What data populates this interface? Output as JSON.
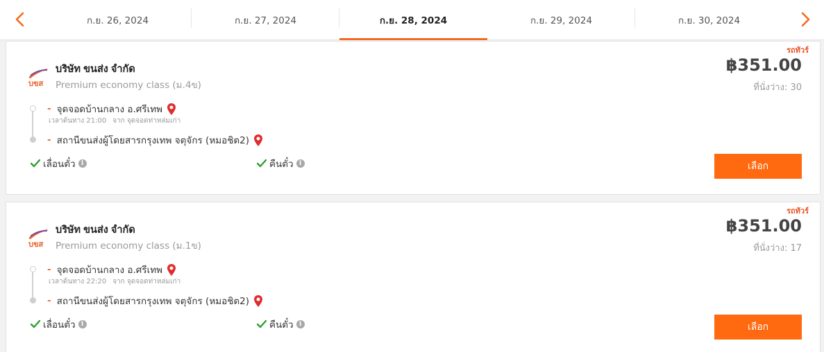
{
  "date_nav": {
    "prev_icon": "chevron-left-icon",
    "next_icon": "chevron-right-icon",
    "accent": "#f26a21",
    "dates": [
      {
        "label": "ก.ย. 26, 2024",
        "active": false
      },
      {
        "label": "ก.ย. 27, 2024",
        "active": false
      },
      {
        "label": "ก.ย. 28, 2024",
        "active": true
      },
      {
        "label": "ก.ย. 29, 2024",
        "active": false
      },
      {
        "label": "ก.ย. 30, 2024",
        "active": false
      }
    ]
  },
  "trips": [
    {
      "company": "บริษัท ขนส่ง จำกัด",
      "logo_text": "บขส",
      "class": "Premium economy class (ม.4ข)",
      "vehicle_type": "รถทัวร์",
      "price": "฿351.00",
      "seats": "ที่นั่งว่าง: 30",
      "from_stop": "จุดจอดบ้านกลาง อ.ศรีเทพ",
      "depart_time": "เวลาต้นทาง 21:00",
      "depart_from": "จาก จุดจอดท่าหล่มเก่า",
      "to_stop": "สถานีขนส่งผู้โดยสารกรุงเทพ จตุจักร (หมอชิต2)",
      "feature_change": "เลื่อนตั๋ว",
      "feature_refund": "คืนตั๋ว",
      "select_label": "เลือก"
    },
    {
      "company": "บริษัท ขนส่ง จำกัด",
      "logo_text": "บขส",
      "class": "Premium economy class (ม.1ข)",
      "vehicle_type": "รถทัวร์",
      "price": "฿351.00",
      "seats": "ที่นั่งว่าง: 17",
      "from_stop": "จุดจอดบ้านกลาง อ.ศรีเทพ",
      "depart_time": "เวลาต้นทาง 22:20",
      "depart_from": "จาก จุดจอดท่าหล่มเก่า",
      "to_stop": "สถานีขนส่งผู้โดยสารกรุงเทพ จตุจักร (หมอชิต2)",
      "feature_change": "เลื่อนตั๋ว",
      "feature_refund": "คืนตั๋ว",
      "select_label": "เลือก"
    }
  ],
  "colors": {
    "select_button": "#ff6a10",
    "check": "#2e9e2e",
    "pin": "#e02d2d",
    "vehicle_type": "#e8501e"
  }
}
